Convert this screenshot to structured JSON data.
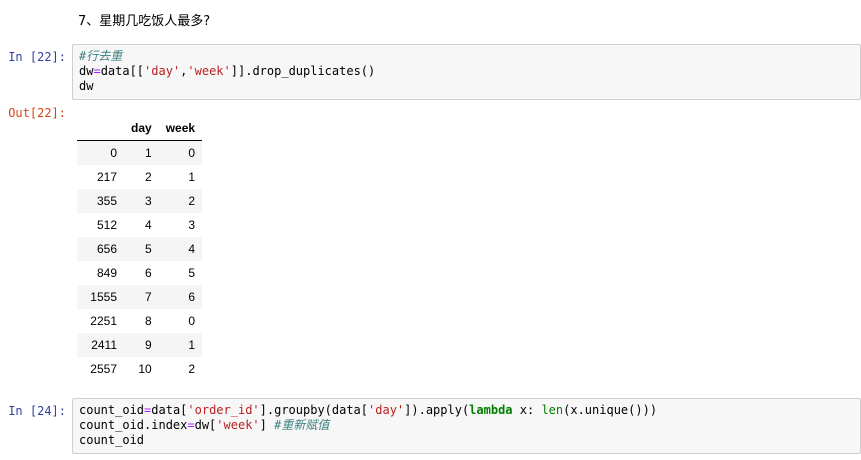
{
  "markdown_heading": "7、星期几吃饭人最多?",
  "cell22": {
    "in_prompt": "In  [22]:",
    "out_prompt": "Out[22]:",
    "code": {
      "line1_comment": "#行去重",
      "line2_a": "dw",
      "line2_op": "=",
      "line2_b": "data[[",
      "line2_s1": "'day'",
      "line2_c": ",",
      "line2_s2": "'week'",
      "line2_d": "]].drop_duplicates()",
      "line3": "dw"
    },
    "table": {
      "columns": [
        "",
        "day",
        "week"
      ],
      "rows": [
        {
          "index": "0",
          "day": "1",
          "week": "0"
        },
        {
          "index": "217",
          "day": "2",
          "week": "1"
        },
        {
          "index": "355",
          "day": "3",
          "week": "2"
        },
        {
          "index": "512",
          "day": "4",
          "week": "3"
        },
        {
          "index": "656",
          "day": "5",
          "week": "4"
        },
        {
          "index": "849",
          "day": "6",
          "week": "5"
        },
        {
          "index": "1555",
          "day": "7",
          "week": "6"
        },
        {
          "index": "2251",
          "day": "8",
          "week": "0"
        },
        {
          "index": "2411",
          "day": "9",
          "week": "1"
        },
        {
          "index": "2557",
          "day": "10",
          "week": "2"
        }
      ]
    }
  },
  "cell24": {
    "in_prompt": "In  [24]:",
    "code": {
      "l1_a": "count_oid",
      "l1_op": "=",
      "l1_b": "data[",
      "l1_s1": "'order_id'",
      "l1_c": "].groupby(data[",
      "l1_s2": "'day'",
      "l1_d": "]).apply(",
      "l1_kw": "lambda",
      "l1_e": " x: ",
      "l1_bi": "len",
      "l1_f": "(x.unique()))",
      "l2_a": "count_oid.index",
      "l2_op": "=",
      "l2_b": "dw[",
      "l2_s": "'week'",
      "l2_c": "] ",
      "l2_comment": "#重新赋值",
      "l3": "count_oid"
    }
  }
}
